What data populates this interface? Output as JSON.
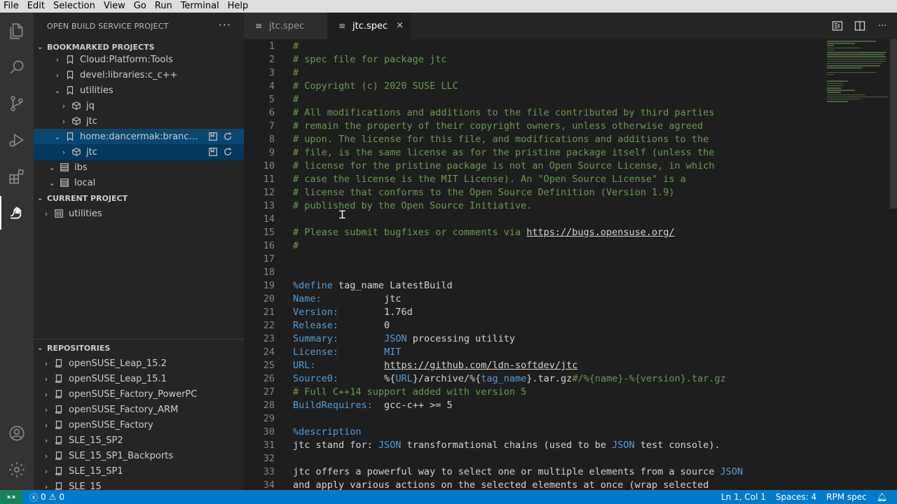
{
  "menu": [
    "File",
    "Edit",
    "Selection",
    "View",
    "Go",
    "Run",
    "Terminal",
    "Help"
  ],
  "sidebar": {
    "title": "OPEN BUILD SERVICE PROJECT",
    "bookmarked": {
      "header": "BOOKMARKED PROJECTS",
      "items": [
        {
          "label": "Cloud:Platform:Tools"
        },
        {
          "label": "devel:libraries:c_c++"
        },
        {
          "label": "utilities"
        },
        {
          "label": "jq"
        },
        {
          "label": "jtc"
        },
        {
          "label": "home:dancermak:branches:..."
        },
        {
          "label": "jtc"
        },
        {
          "label": "ibs"
        },
        {
          "label": "local"
        }
      ]
    },
    "current": {
      "header": "CURRENT PROJECT",
      "items": [
        {
          "label": "utilities"
        }
      ]
    },
    "repositories": {
      "header": "REPOSITORIES",
      "items": [
        {
          "label": "openSUSE_Leap_15.2"
        },
        {
          "label": "openSUSE_Leap_15.1"
        },
        {
          "label": "openSUSE_Factory_PowerPC"
        },
        {
          "label": "openSUSE_Factory_ARM"
        },
        {
          "label": "openSUSE_Factory"
        },
        {
          "label": "SLE_15_SP2"
        },
        {
          "label": "SLE_15_SP1_Backports"
        },
        {
          "label": "SLE_15_SP1"
        },
        {
          "label": "SLE_15"
        }
      ]
    }
  },
  "tabs": [
    {
      "label": "jtc.spec",
      "active": false
    },
    {
      "label": "jtc.spec",
      "active": true
    }
  ],
  "tab_close": "×",
  "editor": {
    "lines": [
      {
        "n": "1",
        "parts": [
          {
            "t": "#",
            "c": "c-com"
          }
        ]
      },
      {
        "n": "2",
        "parts": [
          {
            "t": "# spec file for package jtc",
            "c": "c-com"
          }
        ]
      },
      {
        "n": "3",
        "parts": [
          {
            "t": "#",
            "c": "c-com"
          }
        ]
      },
      {
        "n": "4",
        "parts": [
          {
            "t": "# Copyright (c) 2020 SUSE LLC",
            "c": "c-com"
          }
        ]
      },
      {
        "n": "5",
        "parts": [
          {
            "t": "#",
            "c": "c-com"
          }
        ]
      },
      {
        "n": "6",
        "parts": [
          {
            "t": "# All modifications and additions to the file contributed by third parties",
            "c": "c-com"
          }
        ]
      },
      {
        "n": "7",
        "parts": [
          {
            "t": "# remain the property of their copyright owners, unless otherwise agreed",
            "c": "c-com"
          }
        ]
      },
      {
        "n": "8",
        "parts": [
          {
            "t": "# upon. The license for this file, and modifications and additions to the",
            "c": "c-com"
          }
        ]
      },
      {
        "n": "9",
        "parts": [
          {
            "t": "# file, is the same license as for the pristine package itself (unless the",
            "c": "c-com"
          }
        ]
      },
      {
        "n": "10",
        "parts": [
          {
            "t": "# license for the pristine package is not an Open Source License, in which",
            "c": "c-com"
          }
        ]
      },
      {
        "n": "11",
        "parts": [
          {
            "t": "# case the license is the MIT License). An \"Open Source License\" is a",
            "c": "c-com"
          }
        ]
      },
      {
        "n": "12",
        "parts": [
          {
            "t": "# license that conforms to the Open Source Definition (Version 1.9)",
            "c": "c-com"
          }
        ]
      },
      {
        "n": "13",
        "parts": [
          {
            "t": "# published by the Open Source Initiative.",
            "c": "c-com"
          }
        ]
      },
      {
        "n": "14",
        "parts": []
      },
      {
        "n": "15",
        "parts": [
          {
            "t": "# Please submit bugfixes or comments via ",
            "c": "c-com"
          },
          {
            "t": "https://bugs.opensuse.org/",
            "c": "c-com c-url"
          }
        ]
      },
      {
        "n": "16",
        "parts": [
          {
            "t": "#",
            "c": "c-com"
          }
        ]
      },
      {
        "n": "17",
        "parts": []
      },
      {
        "n": "18",
        "parts": []
      },
      {
        "n": "19",
        "parts": [
          {
            "t": "%define",
            "c": "c-key"
          },
          {
            "t": " tag_name LatestBuild",
            "c": "c-txt"
          }
        ]
      },
      {
        "n": "20",
        "parts": [
          {
            "t": "Name:",
            "c": "c-key"
          },
          {
            "t": "           jtc",
            "c": "c-txt"
          }
        ]
      },
      {
        "n": "21",
        "parts": [
          {
            "t": "Version:",
            "c": "c-key"
          },
          {
            "t": "        1.76d",
            "c": "c-txt"
          }
        ]
      },
      {
        "n": "22",
        "parts": [
          {
            "t": "Release:",
            "c": "c-key"
          },
          {
            "t": "        0",
            "c": "c-txt"
          }
        ]
      },
      {
        "n": "23",
        "parts": [
          {
            "t": "Summary:",
            "c": "c-key"
          },
          {
            "t": "        ",
            "c": "c-txt"
          },
          {
            "t": "JSON",
            "c": "c-json"
          },
          {
            "t": " processing utility",
            "c": "c-txt"
          }
        ]
      },
      {
        "n": "24",
        "parts": [
          {
            "t": "License:",
            "c": "c-key"
          },
          {
            "t": "        ",
            "c": "c-txt"
          },
          {
            "t": "MIT",
            "c": "c-json"
          }
        ]
      },
      {
        "n": "25",
        "parts": [
          {
            "t": "URL:",
            "c": "c-key"
          },
          {
            "t": "            ",
            "c": "c-txt"
          },
          {
            "t": "https://github.com/ldn-softdev/jtc",
            "c": "c-url"
          }
        ]
      },
      {
        "n": "26",
        "parts": [
          {
            "t": "Source0:",
            "c": "c-key"
          },
          {
            "t": "        %{",
            "c": "c-txt"
          },
          {
            "t": "URL",
            "c": "c-json"
          },
          {
            "t": "}/archive/%{",
            "c": "c-txt"
          },
          {
            "t": "tag_name",
            "c": "c-json"
          },
          {
            "t": "}.tar.gz",
            "c": "c-txt"
          },
          {
            "t": "#/%{name}-%{version}.tar.gz",
            "c": "c-com"
          }
        ]
      },
      {
        "n": "27",
        "parts": [
          {
            "t": "# Full C++14 support added with version 5",
            "c": "c-com"
          }
        ]
      },
      {
        "n": "28",
        "parts": [
          {
            "t": "BuildRequires:",
            "c": "c-key"
          },
          {
            "t": "  gcc-c++ >= 5",
            "c": "c-txt"
          }
        ]
      },
      {
        "n": "29",
        "parts": []
      },
      {
        "n": "30",
        "parts": [
          {
            "t": "%description",
            "c": "c-key"
          }
        ]
      },
      {
        "n": "31",
        "parts": [
          {
            "t": "jtc stand for: ",
            "c": "c-txt"
          },
          {
            "t": "JSON",
            "c": "c-json"
          },
          {
            "t": " transformational chains (used to be ",
            "c": "c-txt"
          },
          {
            "t": "JSON",
            "c": "c-json"
          },
          {
            "t": " test console).",
            "c": "c-txt"
          }
        ]
      },
      {
        "n": "32",
        "parts": []
      },
      {
        "n": "33",
        "parts": [
          {
            "t": "jtc offers a powerful way to select one or multiple elements from a source ",
            "c": "c-txt"
          },
          {
            "t": "JSON",
            "c": "c-json"
          }
        ]
      },
      {
        "n": "34",
        "parts": [
          {
            "t": "and apply various actions on the selected elements at once (wrap selected",
            "c": "c-txt"
          }
        ]
      }
    ]
  },
  "status": {
    "errors": "0",
    "warnings": "0",
    "position": "Ln 1, Col 1",
    "spaces": "Spaces: 4",
    "language": "RPM spec"
  }
}
